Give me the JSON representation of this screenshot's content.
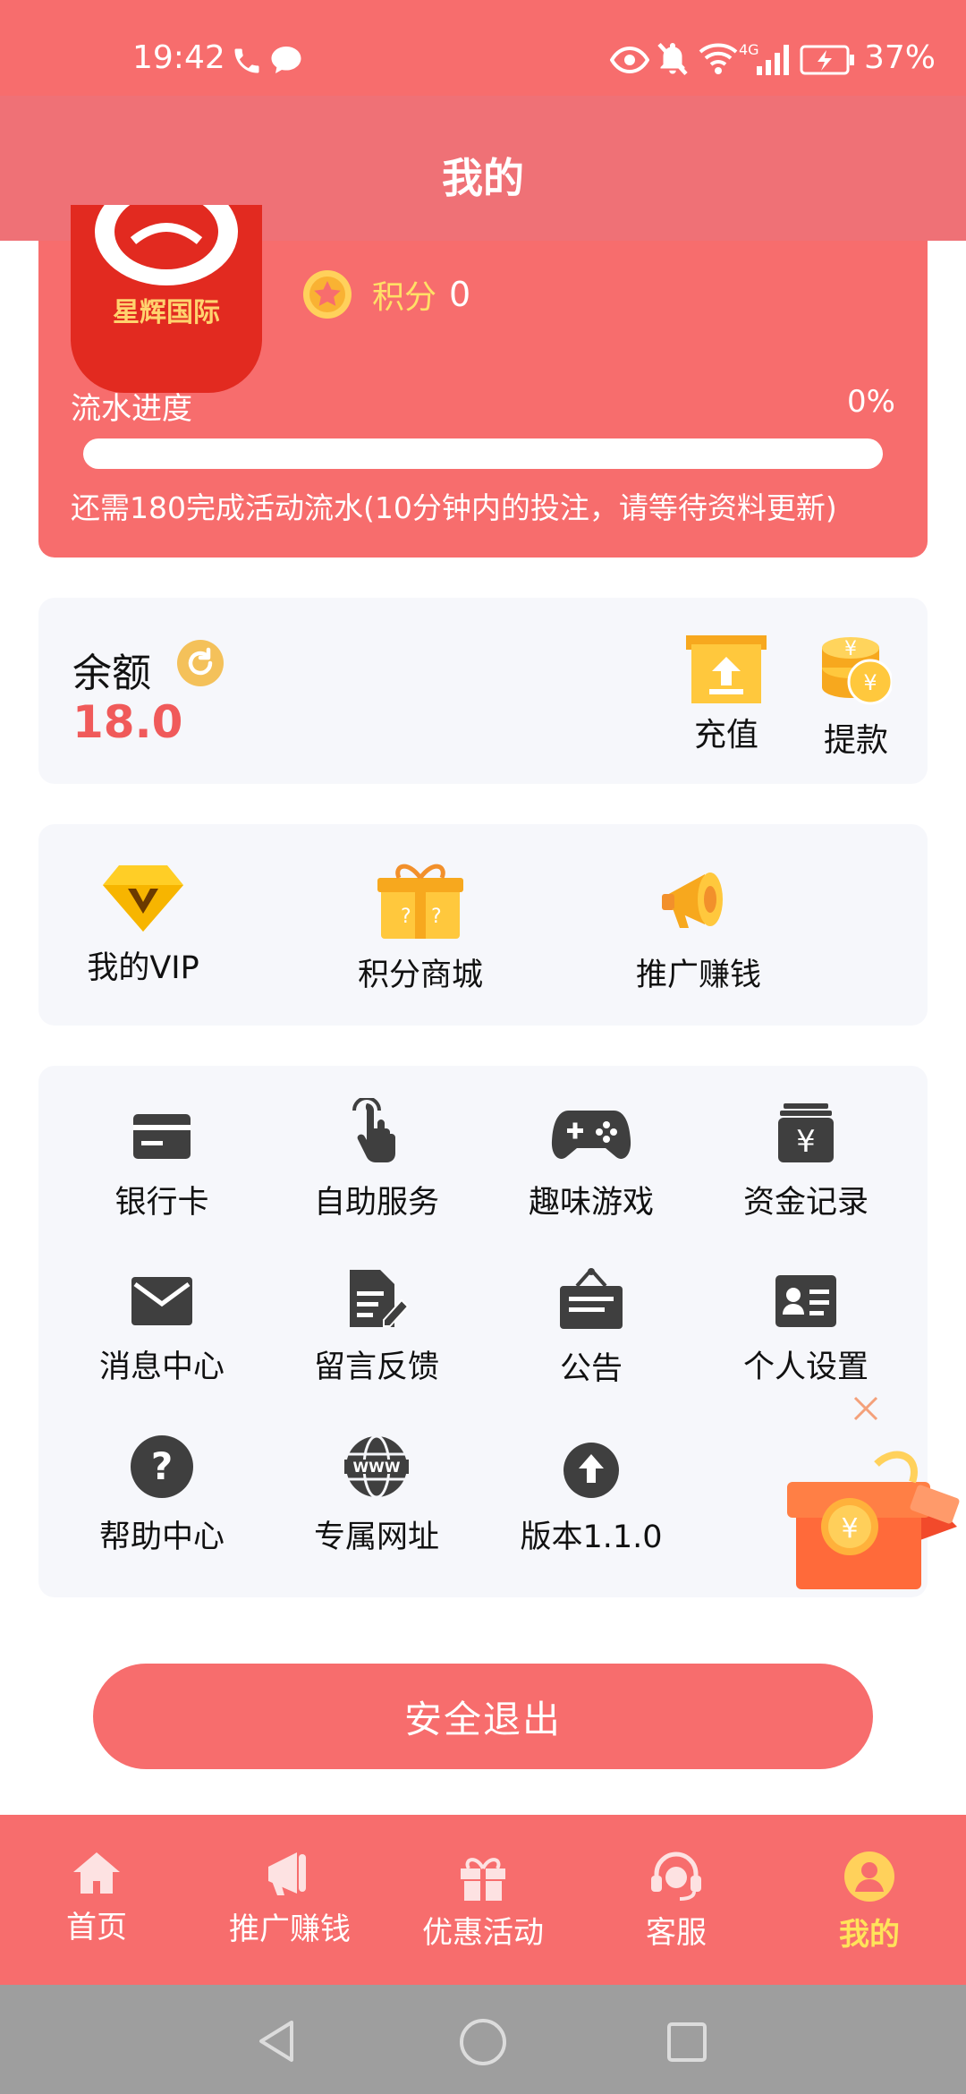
{
  "status_bar": {
    "time": "19:42",
    "battery": "37%",
    "network": "4G"
  },
  "header": {
    "title": "我的"
  },
  "profile": {
    "logo_text": "星辉国际",
    "points_label": "积分",
    "points_value": "0",
    "progress_label": "流水进度",
    "progress_percent": "0%",
    "progress_fraction": 0,
    "progress_note": "还需180完成活动流水(10分钟内的投注，请等待资料更新)"
  },
  "balance": {
    "label": "余额",
    "amount": "18.0",
    "actions": [
      {
        "label": "充值",
        "icon": "deposit-icon"
      },
      {
        "label": "提款",
        "icon": "coins-withdraw-icon"
      }
    ]
  },
  "features": [
    {
      "label": "我的VIP",
      "icon": "vip-diamond-icon"
    },
    {
      "label": "积分商城",
      "icon": "gift-box-icon"
    },
    {
      "label": "推广赚钱",
      "icon": "megaphone-icon"
    }
  ],
  "grid": [
    {
      "label": "银行卡",
      "icon": "bank-card-icon"
    },
    {
      "label": "自助服务",
      "icon": "tap-hand-icon"
    },
    {
      "label": "趣味游戏",
      "icon": "gamepad-icon"
    },
    {
      "label": "资金记录",
      "icon": "fund-record-icon"
    },
    {
      "label": "消息中心",
      "icon": "mail-icon"
    },
    {
      "label": "留言反馈",
      "icon": "feedback-doc-icon"
    },
    {
      "label": "公告",
      "icon": "notice-board-icon"
    },
    {
      "label": "个人设置",
      "icon": "id-card-icon"
    },
    {
      "label": "帮助中心",
      "icon": "help-icon"
    },
    {
      "label": "专属网址",
      "icon": "www-globe-icon"
    },
    {
      "label": "版本1.1.0",
      "icon": "upload-arrow-icon"
    }
  ],
  "logout_label": "安全退出",
  "bottom_nav": [
    {
      "label": "首页",
      "icon": "home-icon"
    },
    {
      "label": "推广赚钱",
      "icon": "megaphone-icon"
    },
    {
      "label": "优惠活动",
      "icon": "gift-icon"
    },
    {
      "label": "客服",
      "icon": "headset-icon"
    },
    {
      "label": "我的",
      "icon": "user-icon",
      "active": true
    }
  ],
  "colors": {
    "primary": "#f76d6d",
    "header": "#ef7176",
    "accent_yellow": "#ffe35a",
    "amount": "#f05a5a",
    "card_bg": "#f6f7fb"
  }
}
